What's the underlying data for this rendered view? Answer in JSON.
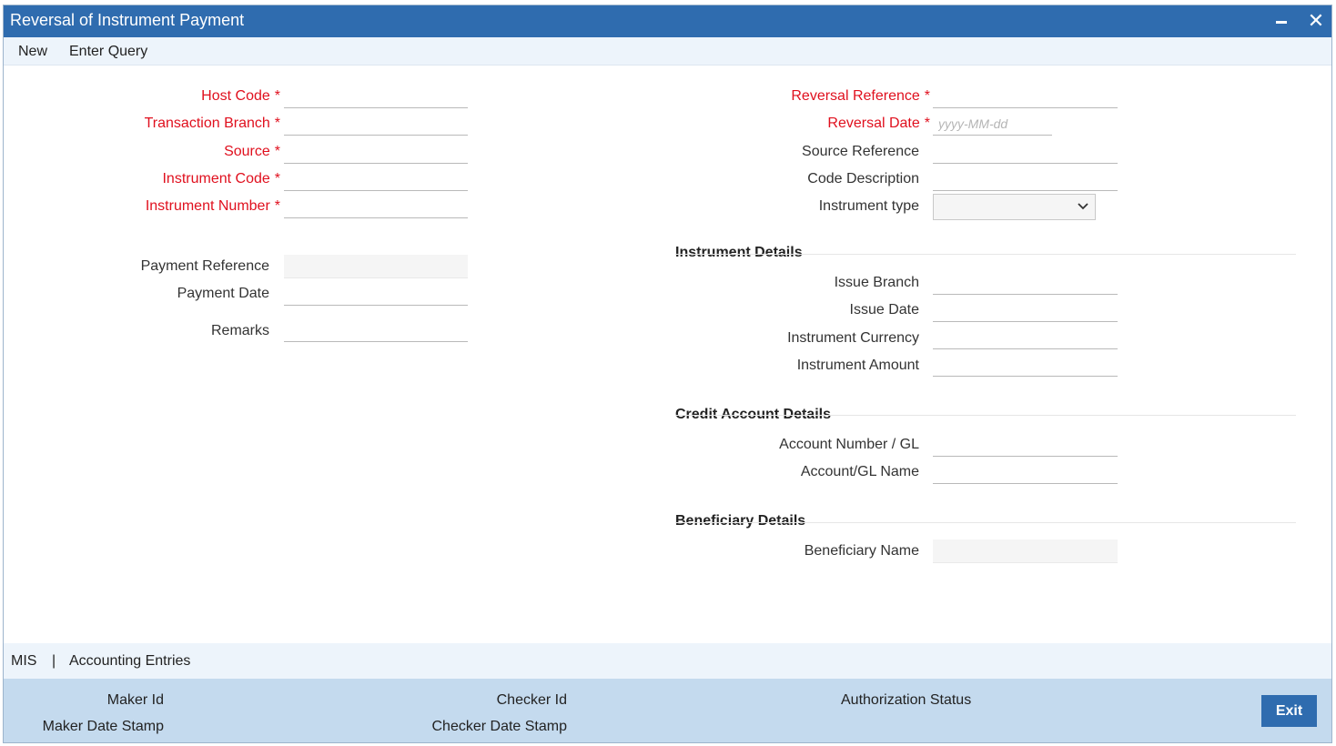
{
  "window": {
    "title": "Reversal of Instrument Payment",
    "minimize_icon": "minimize-icon",
    "close_label": "✕"
  },
  "menu": {
    "new_label": "New",
    "enter_query_label": "Enter Query"
  },
  "left_fields": {
    "host_code": {
      "label": "Host Code",
      "value": ""
    },
    "transaction_branch": {
      "label": "Transaction Branch",
      "value": ""
    },
    "source": {
      "label": "Source",
      "value": ""
    },
    "instrument_code": {
      "label": "Instrument Code",
      "value": ""
    },
    "instrument_number": {
      "label": "Instrument Number",
      "value": ""
    },
    "payment_reference": {
      "label": "Payment Reference",
      "value": ""
    },
    "payment_date": {
      "label": "Payment Date",
      "value": ""
    },
    "remarks": {
      "label": "Remarks",
      "value": ""
    }
  },
  "required_marker": "*",
  "right_fields": {
    "reversal_reference": {
      "label": "Reversal Reference",
      "value": ""
    },
    "reversal_date": {
      "label": "Reversal Date",
      "value": "",
      "placeholder": "yyyy-MM-dd"
    },
    "source_reference": {
      "label": "Source Reference",
      "value": ""
    },
    "code_description": {
      "label": "Code Description",
      "value": ""
    },
    "instrument_type": {
      "label": "Instrument type",
      "selected": ""
    }
  },
  "instrument_details": {
    "title": "Instrument Details",
    "issue_branch": {
      "label": "Issue Branch",
      "value": ""
    },
    "issue_date": {
      "label": "Issue Date",
      "value": ""
    },
    "instrument_currency": {
      "label": "Instrument Currency",
      "value": ""
    },
    "instrument_amount": {
      "label": "Instrument Amount",
      "value": ""
    }
  },
  "credit_account_details": {
    "title": "Credit Account Details",
    "account_number": {
      "label": "Account Number / GL",
      "value": ""
    },
    "account_name": {
      "label": "Account/GL Name",
      "value": ""
    }
  },
  "beneficiary_details": {
    "title": "Beneficiary Details",
    "beneficiary_name": {
      "label": "Beneficiary Name",
      "value": ""
    }
  },
  "tabs": {
    "mis_label": "MIS",
    "separator": "|",
    "accounting_entries_label": "Accounting Entries"
  },
  "footer": {
    "maker_id": "Maker Id",
    "maker_date_stamp": "Maker Date Stamp",
    "checker_id": "Checker Id",
    "checker_date_stamp": "Checker Date Stamp",
    "authorization_status": "Authorization Status",
    "exit_label": "Exit"
  },
  "colors": {
    "titlebar": "#2f6caf",
    "required": "#e0101e",
    "footer": "#c4daee",
    "menubar": "#edf4fb"
  }
}
